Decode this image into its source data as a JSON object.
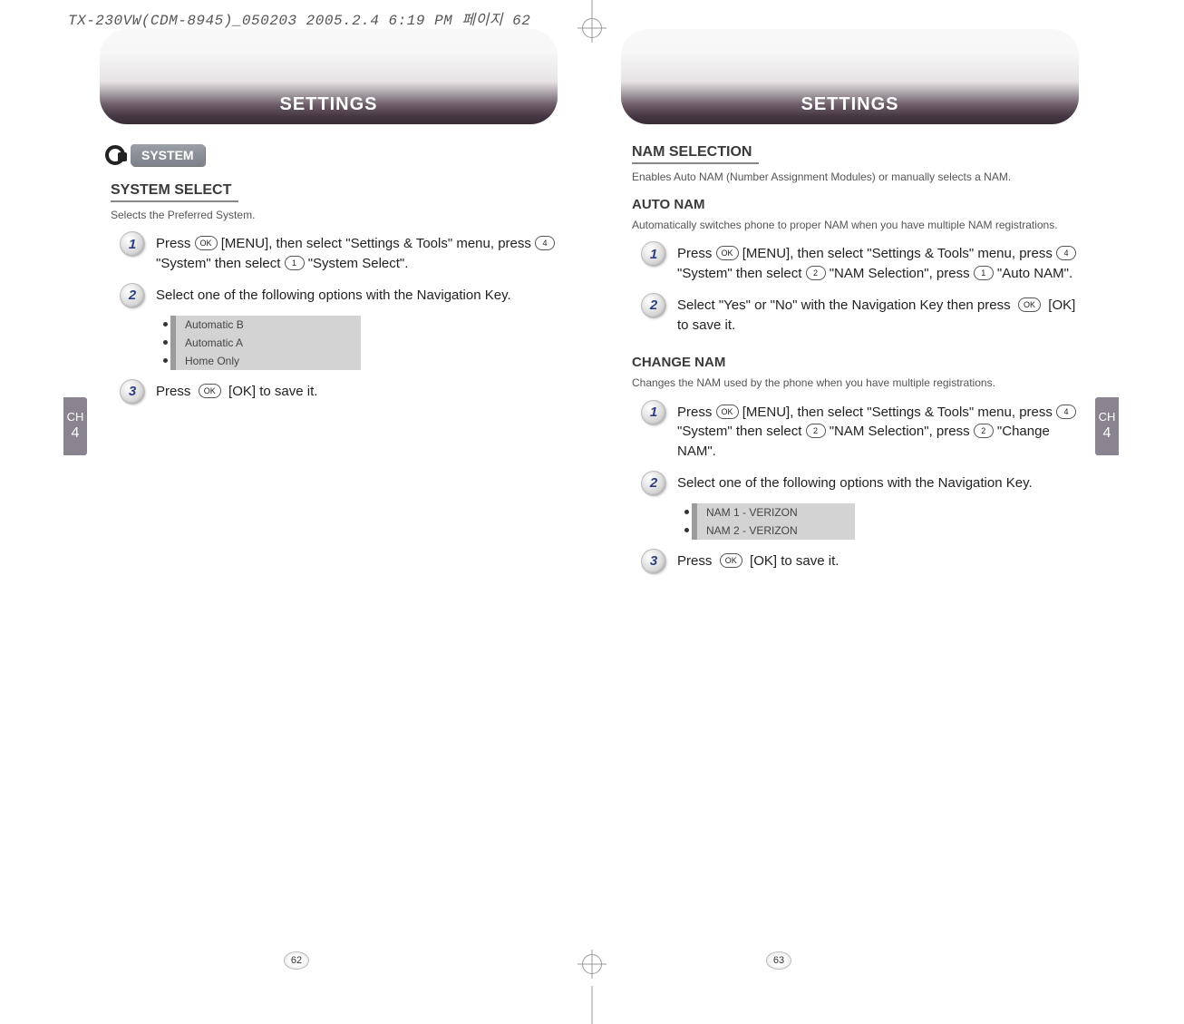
{
  "print_header": "TX-230VW(CDM-8945)_050203  2005.2.4 6:19 PM  페이지 62",
  "ch_label": "CH",
  "ch_num": "4",
  "left": {
    "banner": "SETTINGS",
    "system_badge": "SYSTEM",
    "sec1_title": "SYSTEM SELECT",
    "sec1_desc": "Selects the Preferred System.",
    "steps": {
      "s1": "Press [OK] [MENU], then select \"Settings & Tools\" menu, press [4] \"System\" then select [1] \"System Select\".",
      "s2": "Select one of the following options with the Navigation Key.",
      "s3": "Press  [OK]  [OK] to save it."
    },
    "options": [
      "Automatic B",
      "Automatic A",
      "Home Only"
    ],
    "page_num": "62"
  },
  "right": {
    "banner": "SETTINGS",
    "sec_nam_title": "NAM SELECTION",
    "sec_nam_desc": "Enables Auto NAM (Number Assignment Modules) or manually selects a NAM.",
    "auto_nam_heading": "AUTO NAM",
    "auto_nam_desc": "Automatically switches phone to proper NAM when you have multiple NAM registrations.",
    "auto_steps": {
      "s1": "Press [OK] [MENU], then select \"Settings & Tools\" menu, press [4] \"System\" then select [2] \"NAM Selection\", press [1] \"Auto NAM\".",
      "s2": "Select \"Yes\" or \"No\" with the Navigation Key then press  [OK]  [OK] to save it."
    },
    "change_nam_heading": "CHANGE NAM",
    "change_nam_desc": "Changes the NAM used by the phone when you have multiple registrations.",
    "change_steps": {
      "s1": "Press [OK] [MENU], then select \"Settings & Tools\" menu, press [4] \"System\" then select [2] \"NAM Selection\", press [2] \"Change NAM\".",
      "s2": "Select one of the following options with the Navigation Key.",
      "s3": "Press  [OK]  [OK] to save it."
    },
    "options": [
      "NAM 1 - VERIZON",
      "NAM 2 - VERIZON"
    ],
    "page_num": "63"
  },
  "keys": {
    "ok": "OK",
    "k1": "1",
    "k2": "2",
    "k4": "4"
  }
}
